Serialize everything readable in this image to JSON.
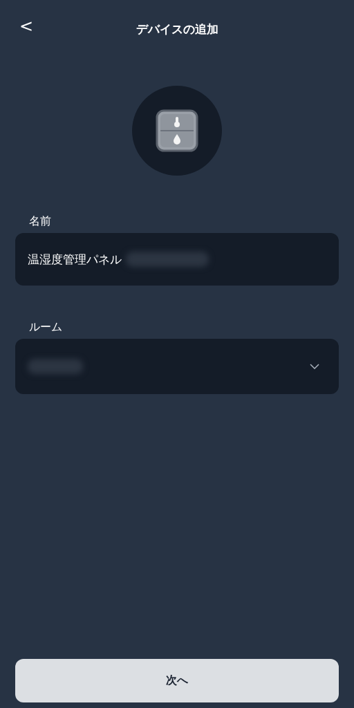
{
  "header": {
    "back": "<",
    "title": "デバイスの追加"
  },
  "fields": [
    {
      "label": "名前",
      "value": "温湿度管理パネル",
      "kind": "text"
    },
    {
      "label": "ルーム",
      "kind": "select"
    }
  ],
  "next_button": "次へ"
}
